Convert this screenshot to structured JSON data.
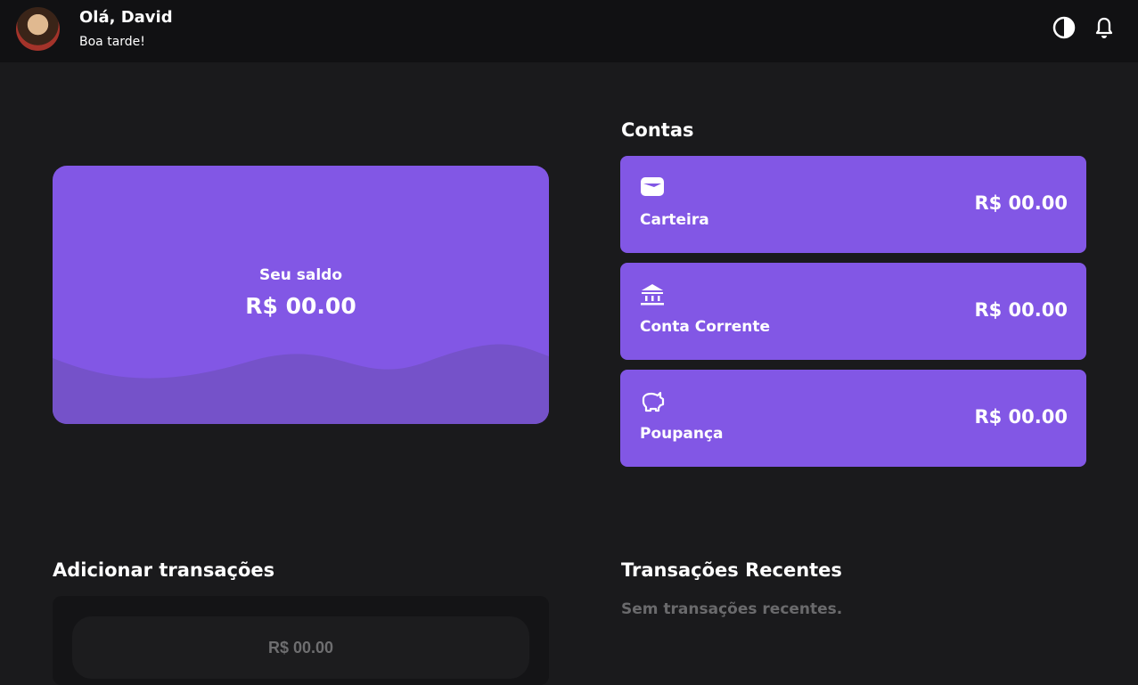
{
  "header": {
    "greeting": "Olá, David",
    "subtitle": "Boa tarde!",
    "icons": [
      "theme-toggle-icon",
      "bell-icon"
    ]
  },
  "balance": {
    "label": "Seu saldo",
    "value": "R$ 00.00"
  },
  "accounts": {
    "title": "Contas",
    "items": [
      {
        "name": "Carteira",
        "amount": "R$ 00.00",
        "icon": "wallet-icon"
      },
      {
        "name": "Conta Corrente",
        "amount": "R$ 00.00",
        "icon": "bank-icon"
      },
      {
        "name": "Poupança",
        "amount": "R$ 00.00",
        "icon": "piggy-bank-icon"
      }
    ]
  },
  "add_transaction": {
    "title": "Adicionar transações",
    "amount_placeholder": "R$ 00.00"
  },
  "recent": {
    "title": "Transações Recentes",
    "empty": "Sem transações recentes."
  },
  "colors": {
    "accent": "#8257e5",
    "background": "#1a1a1c",
    "header": "#111113"
  }
}
